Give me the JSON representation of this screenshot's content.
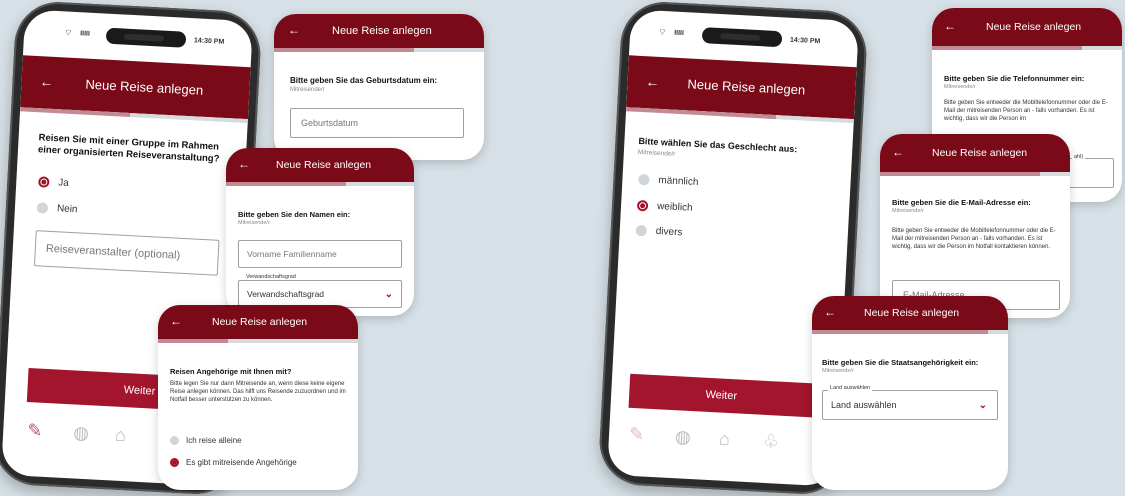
{
  "status": {
    "time": "14:30 PM",
    "battery": "IIIII"
  },
  "appbar_title": "Neue Reise anlegen",
  "back_arrow": "←",
  "left_phone": {
    "question": "Reisen Sie mit einer Gruppe im Rahmen einer organisierten Reiseveranstaltung?",
    "options": [
      {
        "label": "Ja",
        "selected": true
      },
      {
        "label": "Nein",
        "selected": false
      }
    ],
    "input_placeholder": "Reiseveranstalter (optional)",
    "button": "Weiter"
  },
  "card_birthdate": {
    "question": "Bitte geben Sie das Geburtsdatum ein:",
    "subtitle": "Mitreisende/r",
    "input_placeholder": "Geburtsdatum"
  },
  "card_name": {
    "question": "Bitte geben Sie den Namen ein:",
    "subtitle": "Mitreisende/r",
    "name_placeholder": "Vorname Familienname",
    "relation_legend": "Verwandschaftsgrad",
    "relation_value": "Verwandschaftsgrad"
  },
  "card_relatives": {
    "question": "Reisen Angehörige mit Ihnen mit?",
    "text": "Bitte legen Sie nur dann Mitreisende an, wenn diese keine eigene Reise anlegen können. Das hilft uns Reisende zuzuordnen und im Notfall besser unterstützen zu können.",
    "options": [
      {
        "label": "Ich reise alleine",
        "selected": false
      },
      {
        "label": "Es gibt mitreisende Angehörige",
        "selected": true
      }
    ]
  },
  "right_phone": {
    "question": "Bitte wählen Sie das Geschlecht aus:",
    "subtitle": "Mitreisende/r",
    "options": [
      {
        "label": "männlich",
        "selected": false
      },
      {
        "label": "weiblich",
        "selected": true
      },
      {
        "label": "divers",
        "selected": false
      }
    ],
    "button": "Weiter"
  },
  "card_phone": {
    "question": "Bitte geben Sie die Telefonnummer ein:",
    "subtitle": "Mitreisende/r",
    "text": "Bitte geben Sie entweder die Mobiltelefonnummer oder die E-Mail der mitreisenden Person an - falls vorhanden. Es ist wichtig, dass wir die Person im",
    "legend_fragment": "ahl)"
  },
  "card_email": {
    "question": "Bitte geben Sie die E-Mail-Adresse ein:",
    "subtitle": "Mitreisende/r",
    "text": "Bitte geben Sie entweder die Mobiltelefonnummer oder die E-Mail der mitreisenden Person an - falls vorhanden. Es ist wichtig, dass wir die Person im Notfall kontaktieren können.",
    "input_placeholder": "E-Mail-Adresse"
  },
  "card_nationality": {
    "question": "Bitte geben Sie die Staatsangehörigkeit ein:",
    "subtitle": "Mitreisende/r",
    "legend": "Land auswählen",
    "value": "Land auswählen"
  },
  "colors": {
    "brand": "#7a0a17",
    "button": "#a3152d",
    "progress_track": "#d6dbe0",
    "progress_fill": "#c28b94"
  }
}
